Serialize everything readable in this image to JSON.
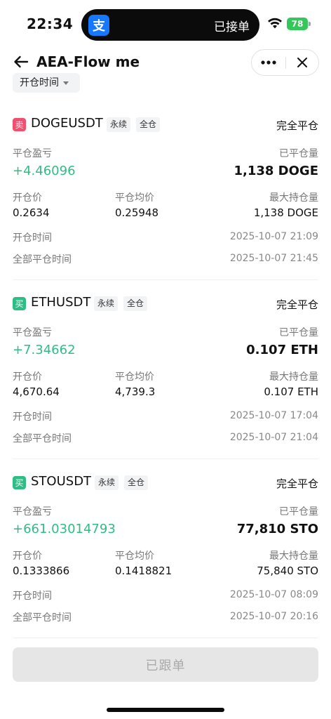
{
  "status_bar": {
    "time": "22:34",
    "island_text": "已接单",
    "alipay_glyph": "支",
    "battery": "78"
  },
  "nav": {
    "title": "AEA-Flow me",
    "back_icon": "back-arrow-icon",
    "more_icon": "more-dots-icon",
    "close_icon": "close-icon"
  },
  "filter": {
    "label": "开仓时间"
  },
  "labels": {
    "close_pnl": "平仓盈亏",
    "closed_qty": "已平仓量",
    "open_price": "开仓价",
    "avg_close_price": "平仓均价",
    "max_position": "最大持仓量",
    "open_time": "开仓时间",
    "full_close_time": "全部平仓时间"
  },
  "positions": [
    {
      "side": "卖",
      "side_color": "#f0506e",
      "symbol": "DOGEUSDT",
      "type_tag": "永续",
      "margin_tag": "全仓",
      "status": "完全平仓",
      "pnl": "+4.46096",
      "closed_qty": "1,138 DOGE",
      "open_price": "0.2634",
      "avg_close_price": "0.25948",
      "max_position": "1,138 DOGE",
      "open_time": "2025-10-07 21:09",
      "full_close_time": "2025-10-07 21:45"
    },
    {
      "side": "买",
      "side_color": "#2ebd85",
      "symbol": "ETHUSDT",
      "type_tag": "永续",
      "margin_tag": "全仓",
      "status": "完全平仓",
      "pnl": "+7.34662",
      "closed_qty": "0.107 ETH",
      "open_price": "4,670.64",
      "avg_close_price": "4,739.3",
      "max_position": "0.107 ETH",
      "open_time": "2025-10-07 17:04",
      "full_close_time": "2025-10-07 21:04"
    },
    {
      "side": "买",
      "side_color": "#2ebd85",
      "symbol": "STOUSDT",
      "type_tag": "永续",
      "margin_tag": "全仓",
      "status": "完全平仓",
      "pnl": "+661.03014793",
      "closed_qty": "77,810 STO",
      "open_price": "0.1333866",
      "avg_close_price": "0.1418821",
      "max_position": "75,840 STO",
      "open_time": "2025-10-07 08:09",
      "full_close_time": "2025-10-07 20:16"
    }
  ],
  "footer": {
    "button_label": "已跟单"
  },
  "colors": {
    "profit": "#2ebd85",
    "sell": "#f0506e",
    "buy": "#2ebd85",
    "battery": "#34c759",
    "alipay": "#1677ff"
  }
}
